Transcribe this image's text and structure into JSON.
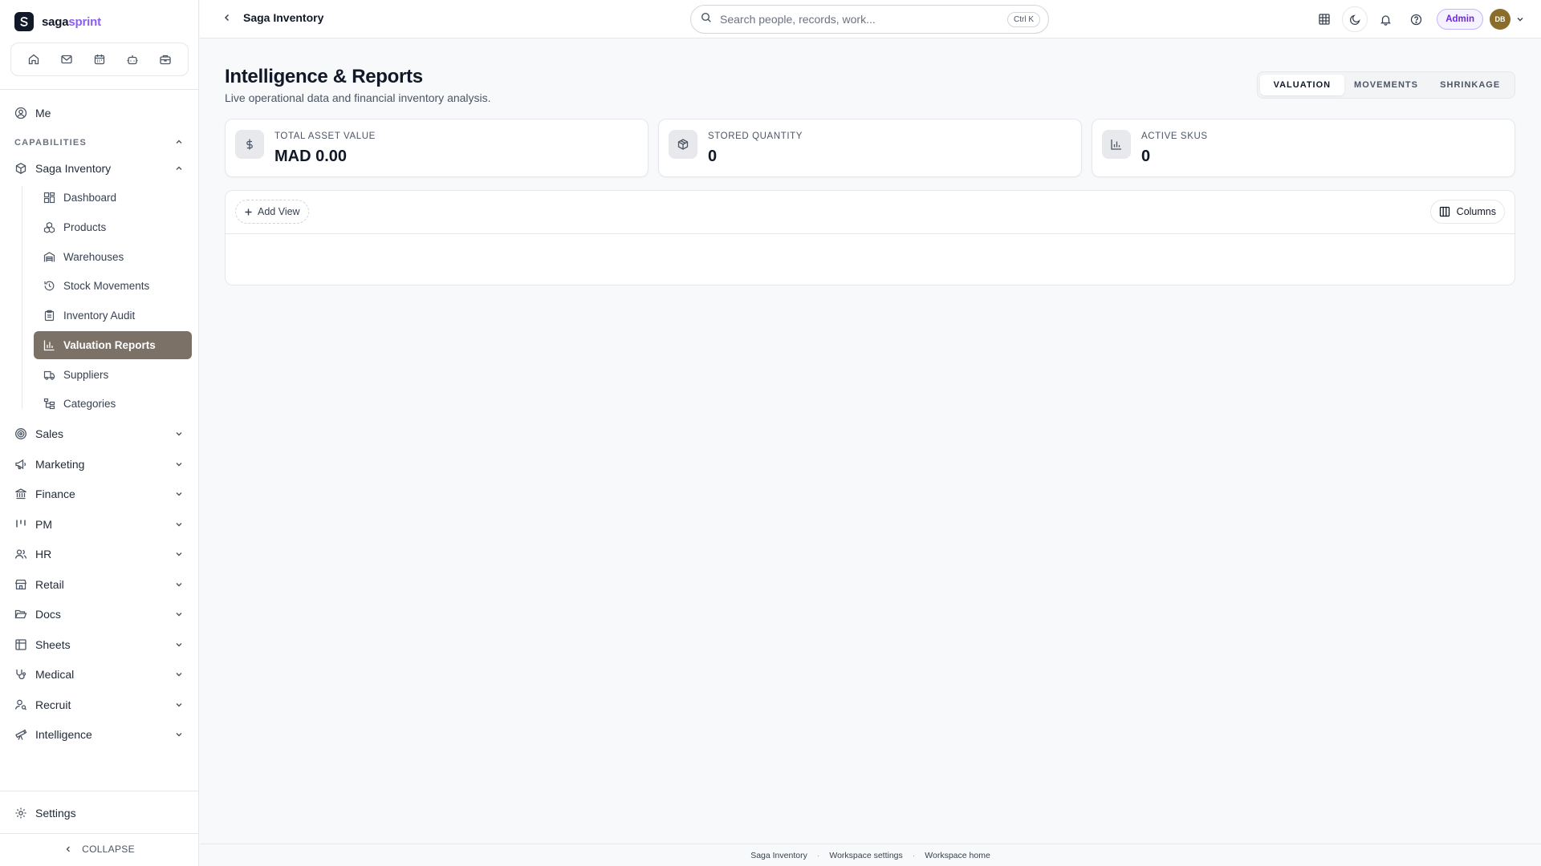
{
  "brand": {
    "name_prefix": "saga",
    "name_suffix": "sprint",
    "logo_letter": "S"
  },
  "quick_icons": [
    "home-icon",
    "mail-icon",
    "calendar-icon",
    "bot-icon",
    "briefcase-icon"
  ],
  "sidebar": {
    "me_label": "Me",
    "capabilities_label": "CAPABILITIES",
    "module": {
      "label": "Saga Inventory",
      "icon": "box-icon"
    },
    "sub_items": [
      {
        "label": "Dashboard",
        "icon": "dashboard-icon",
        "active": false
      },
      {
        "label": "Products",
        "icon": "boxes-icon",
        "active": false
      },
      {
        "label": "Warehouses",
        "icon": "warehouse-icon",
        "active": false
      },
      {
        "label": "Stock Movements",
        "icon": "history-icon",
        "active": false
      },
      {
        "label": "Inventory Audit",
        "icon": "clipboard-icon",
        "active": false
      },
      {
        "label": "Valuation Reports",
        "icon": "bar-chart-icon",
        "active": true
      },
      {
        "label": "Suppliers",
        "icon": "truck-icon",
        "active": false
      },
      {
        "label": "Categories",
        "icon": "tree-icon",
        "active": false
      }
    ],
    "groups": [
      {
        "label": "Sales",
        "icon": "target-icon"
      },
      {
        "label": "Marketing",
        "icon": "megaphone-icon"
      },
      {
        "label": "Finance",
        "icon": "bank-icon"
      },
      {
        "label": "PM",
        "icon": "kanban-icon"
      },
      {
        "label": "HR",
        "icon": "users-icon"
      },
      {
        "label": "Retail",
        "icon": "store-icon"
      },
      {
        "label": "Docs",
        "icon": "folder-icon"
      },
      {
        "label": "Sheets",
        "icon": "table-icon"
      },
      {
        "label": "Medical",
        "icon": "stethoscope-icon"
      },
      {
        "label": "Recruit",
        "icon": "user-search-icon"
      },
      {
        "label": "Intelligence",
        "icon": "telescope-icon"
      }
    ],
    "settings_label": "Settings",
    "collapse_label": "COLLAPSE"
  },
  "topbar": {
    "breadcrumb": "Saga Inventory",
    "search_placeholder": "Search people, records, work...",
    "search_shortcut": "Ctrl K",
    "admin_label": "Admin",
    "avatar_initials": "DB"
  },
  "main": {
    "title": "Intelligence & Reports",
    "subtitle": "Live operational data and financial inventory analysis.",
    "tabs": [
      {
        "label": "VALUATION",
        "active": true
      },
      {
        "label": "MOVEMENTS",
        "active": false
      },
      {
        "label": "SHRINKAGE",
        "active": false
      }
    ],
    "stats": [
      {
        "label": "TOTAL ASSET VALUE",
        "value": "MAD 0.00",
        "icon": "dollar-icon"
      },
      {
        "label": "STORED QUANTITY",
        "value": "0",
        "icon": "package-icon"
      },
      {
        "label": "ACTIVE SKUS",
        "value": "0",
        "icon": "bar-chart-icon"
      }
    ],
    "add_view_label": "Add View",
    "columns_label": "Columns"
  },
  "footer": {
    "links": [
      "Saga Inventory",
      "Workspace settings",
      "Workspace home"
    ],
    "separator": "·"
  },
  "colors": {
    "accent": "#8b5cf6",
    "active_nav_bg": "#7b7166",
    "avatar_bg": "#8a6d2b",
    "admin_text": "#6d28d9"
  }
}
